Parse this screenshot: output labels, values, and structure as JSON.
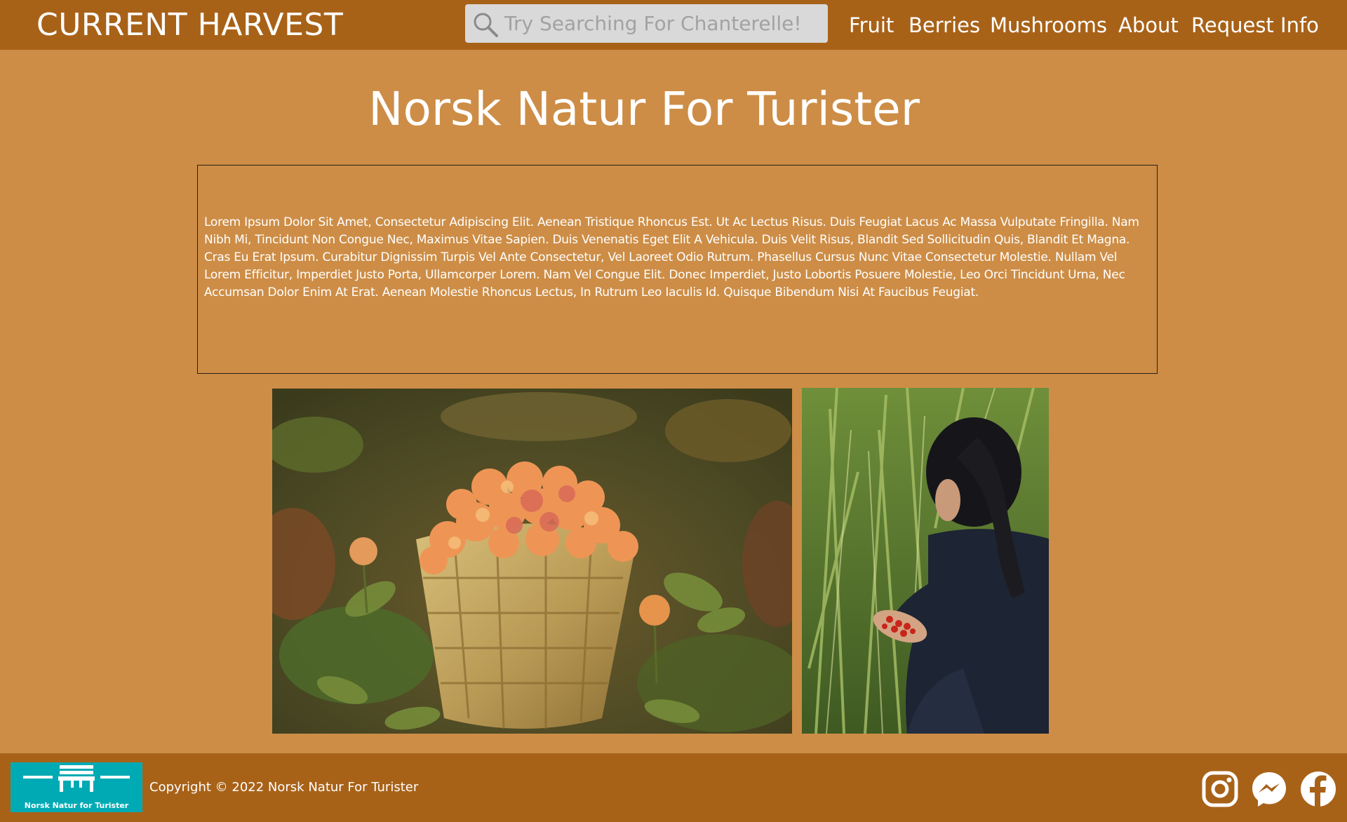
{
  "header": {
    "brand": "CURRENT HARVEST",
    "search_placeholder": "Try Searching For Chanterelle!",
    "nav": [
      "Fruit",
      "Berries",
      "Mushrooms",
      "About",
      "Request Info"
    ]
  },
  "main": {
    "title": "Norsk Natur For Turister",
    "body_text": "Lorem Ipsum Dolor Sit Amet, Consectetur Adipiscing Elit. Aenean Tristique Rhoncus Est. Ut Ac Lectus Risus. Duis Feugiat Lacus Ac Massa Vulputate Fringilla. Nam Nibh Mi, Tincidunt Non Congue Nec, Maximus Vitae Sapien. Duis Venenatis Eget Elit A Vehicula. Duis Velit Risus, Blandit Sed Sollicitudin Quis, Blandit Et Magna. Cras Eu Erat Ipsum. Curabitur Dignissim Turpis Vel Ante Consectetur, Vel Laoreet Odio Rutrum. Phasellus Cursus Nunc Vitae Consectetur Molestie. Nullam Vel Lorem Efficitur, Imperdiet Justo Porta, Ullamcorper Lorem. Nam Vel Congue Elit. Donec Imperdiet, Justo Lobortis Posuere Molestie, Leo Orci Tincidunt Urna, Nec Accumsan Dolor Enim At Erat. Aenean Molestie Rhoncus Lectus, In Rutrum Leo Iaculis Id. Quisque Bibendum Nisi At Faucibus Feugiat."
  },
  "footer": {
    "logo_text": "Norsk Natur for Turister",
    "copyright": "Copyright © 2022 Norsk Natur For Turister",
    "social_icons": [
      "instagram-icon",
      "messenger-icon",
      "facebook-icon"
    ]
  },
  "colors": {
    "page_background": "#cd8d46",
    "bar_background": "#a86218",
    "logo_background": "#00aab4",
    "text": "#ffffff"
  }
}
